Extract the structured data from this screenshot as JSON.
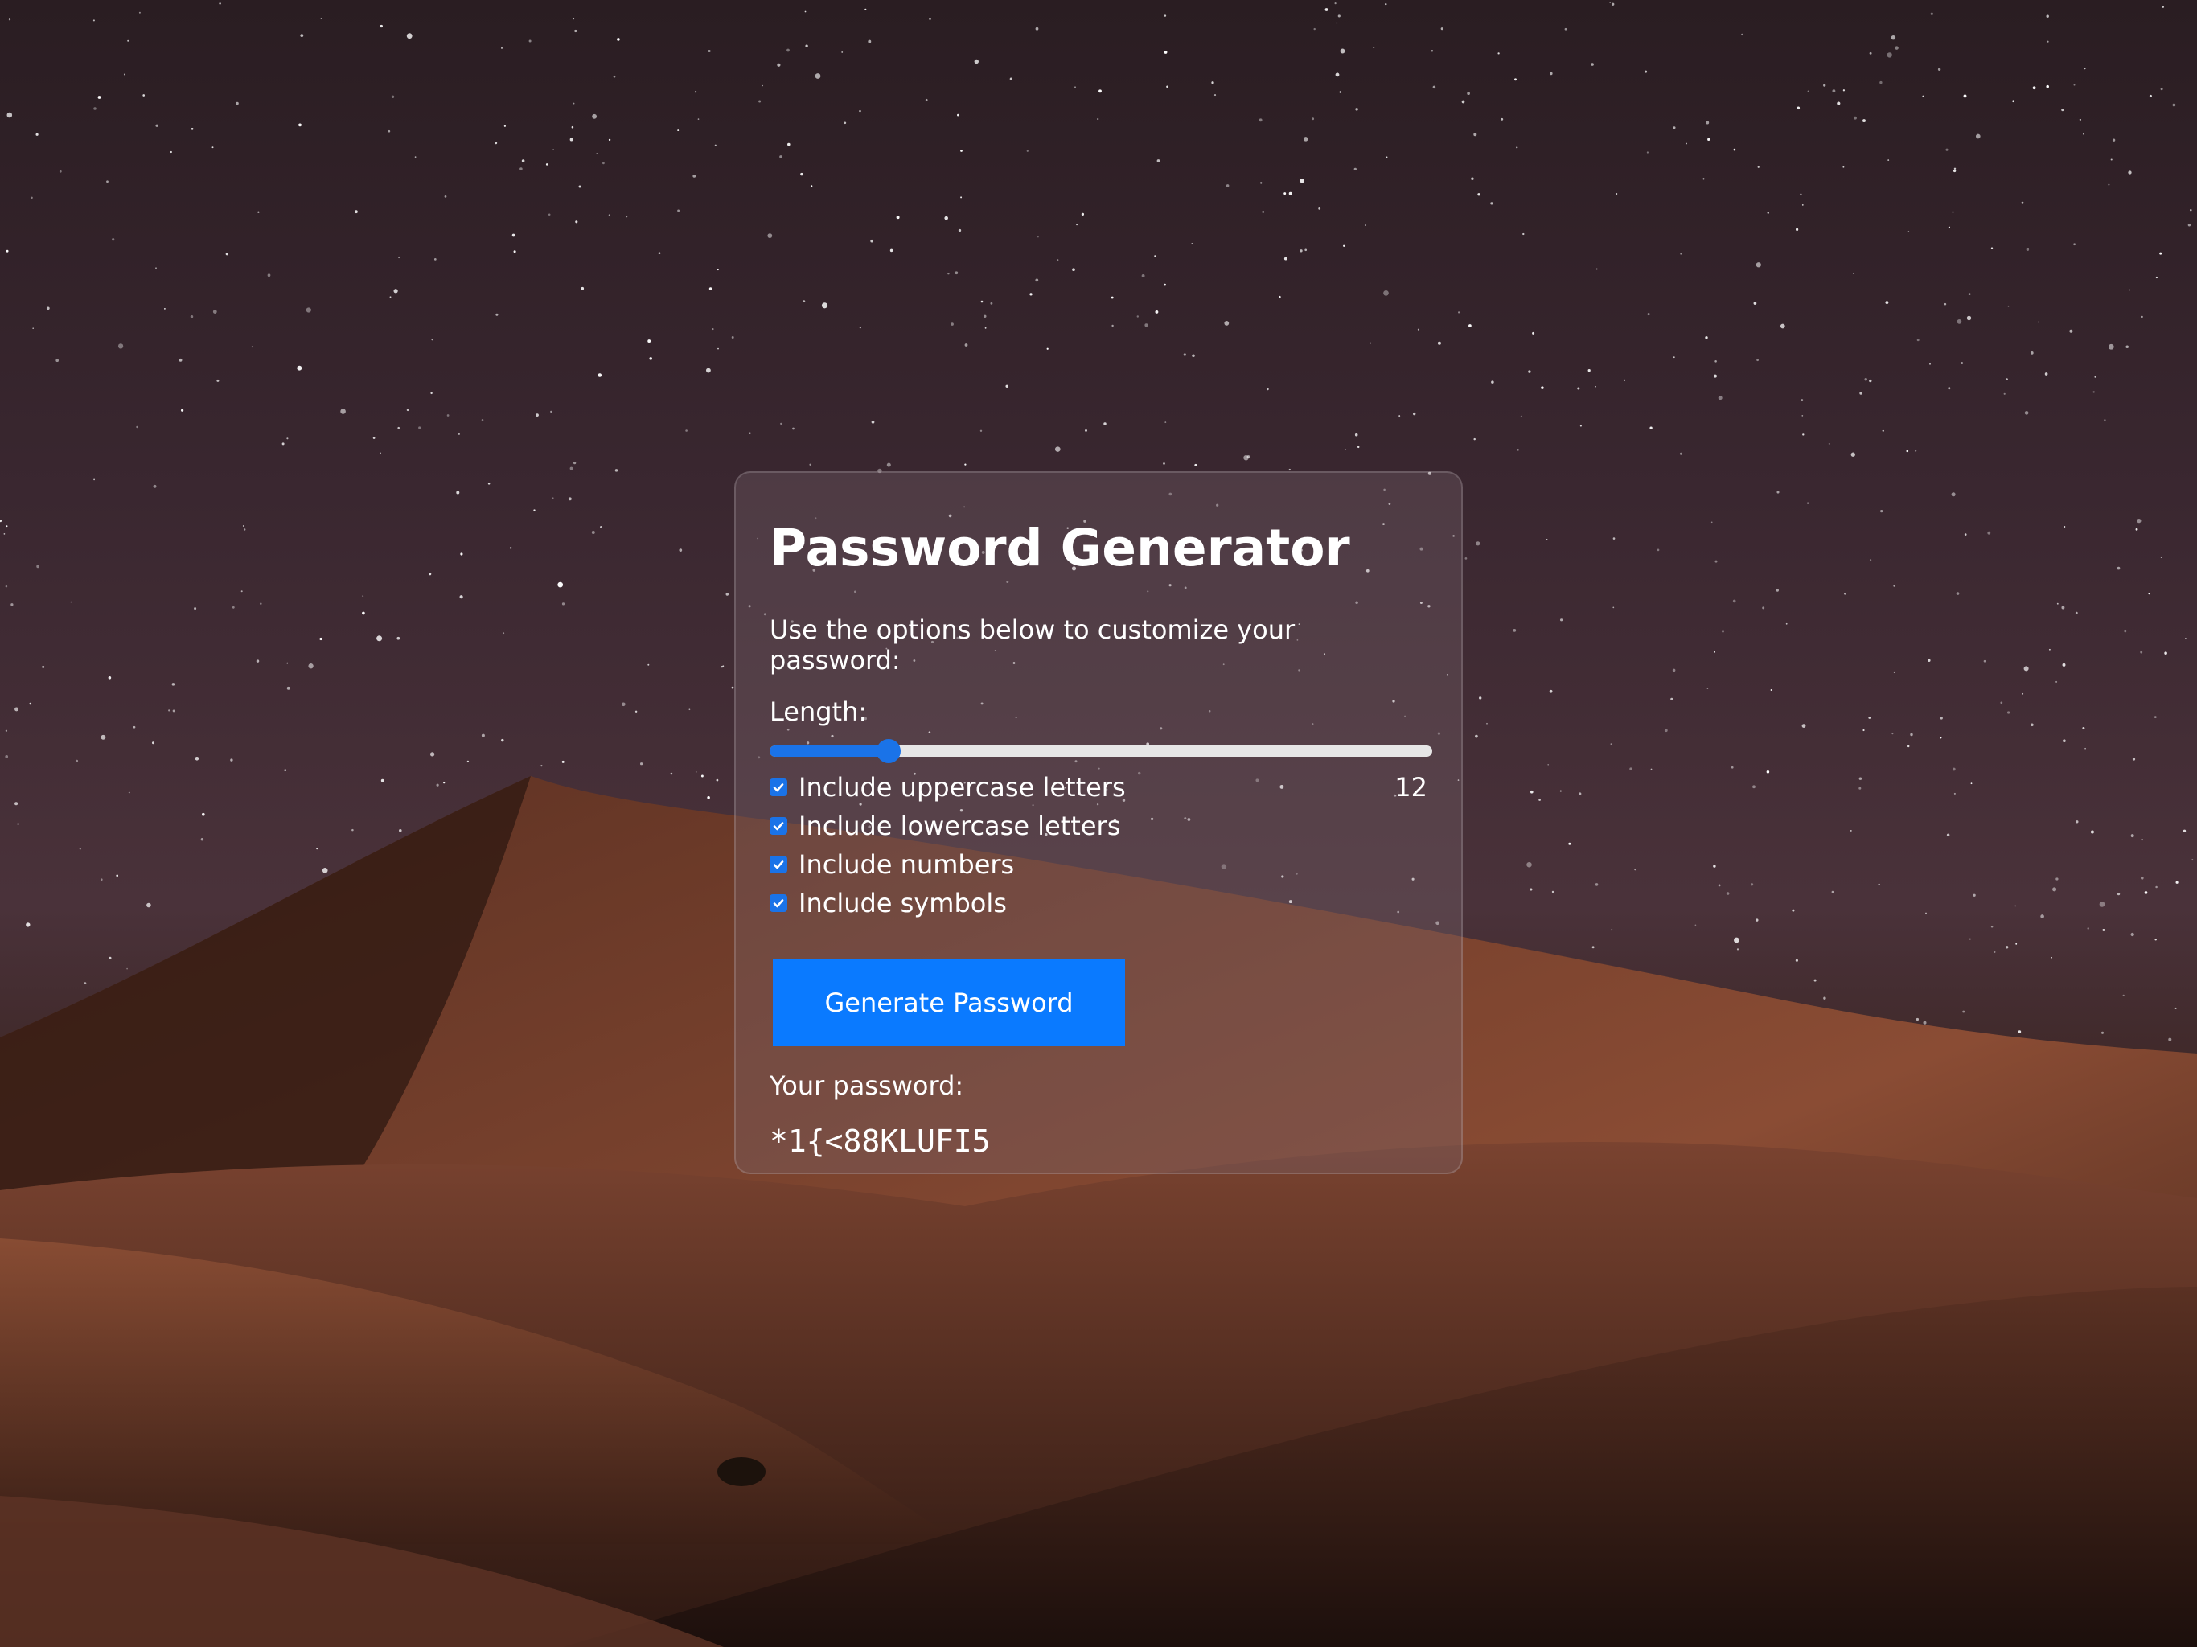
{
  "app": {
    "title": "Password Generator",
    "subtitle": "Use the options below to customize your password:"
  },
  "length": {
    "label": "Length:",
    "value": "12",
    "min": 4,
    "max": 64,
    "fill_fraction": 0.18
  },
  "options": [
    {
      "label": "Include uppercase letters",
      "checked": true
    },
    {
      "label": "Include lowercase letters",
      "checked": true
    },
    {
      "label": "Include numbers",
      "checked": true
    },
    {
      "label": "Include symbols",
      "checked": true
    }
  ],
  "generate_button": {
    "label": "Generate Password"
  },
  "result": {
    "label": "Your password:",
    "password": "*1{<88KLUFI5"
  },
  "colors": {
    "accent": "#0a7aff",
    "slider": "#1a73e8"
  }
}
